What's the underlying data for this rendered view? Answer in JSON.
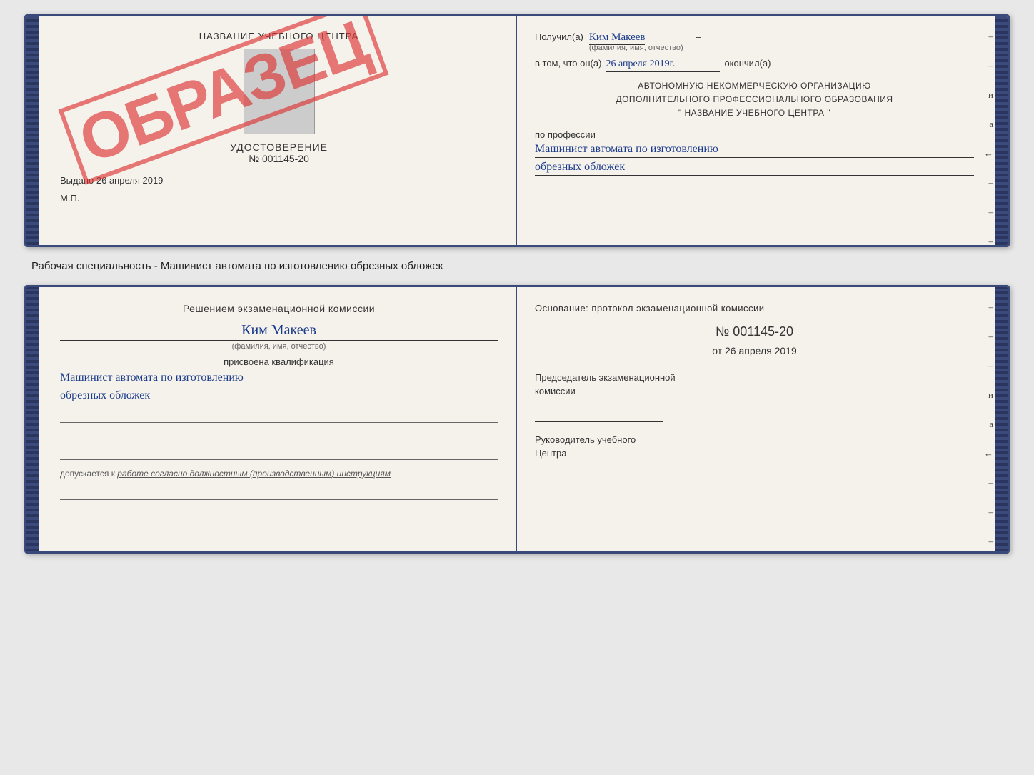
{
  "top_document": {
    "left": {
      "title": "НАЗВАНИЕ УЧЕБНОГО ЦЕНТРА",
      "photo_alt": "фото",
      "certificate_label": "УДОСТОВЕРЕНИЕ",
      "number_label": "№ 001145-20",
      "issued_text": "Выдано",
      "issued_date": "26 апреля 2019",
      "mp_label": "М.П.",
      "stamp_text": "ОБРАЗЕЦ"
    },
    "right": {
      "recipient_prefix": "Получил(а)",
      "recipient_name": "Ким Макеев",
      "recipient_sublabel": "(фамилия, имя, отчество)",
      "date_prefix": "в том, что он(а)",
      "date_value": "26 апреля 2019г.",
      "finished_label": "окончил(а)",
      "org_line1": "АВТОНОМНУЮ НЕКОММЕРЧЕСКУЮ ОРГАНИЗАЦИЮ",
      "org_line2": "ДОПОЛНИТЕЛЬНОГО ПРОФЕССИОНАЛЬНОГО ОБРАЗОВАНИЯ",
      "org_line3": "\"   НАЗВАНИЕ УЧЕБНОГО ЦЕНТРА   \"",
      "profession_label": "по профессии",
      "profession_line1": "Машинист автомата по изготовлению",
      "profession_line2": "обрезных обложек",
      "right_markers": [
        "–",
        "–",
        "–",
        "и",
        "а",
        "←",
        "–",
        "–",
        "–",
        "–"
      ]
    }
  },
  "specialty_text": "Рабочая специальность - Машинист автомата по изготовлению обрезных обложек",
  "bottom_document": {
    "left": {
      "commission_line1": "Решением  экзаменационной  комиссии",
      "person_name": "Ким Макеев",
      "person_sublabel": "(фамилия, имя, отчество)",
      "qualification_label": "присвоена квалификация",
      "qualification_line1": "Машинист автомата по изготовлению",
      "qualification_line2": "обрезных обложек",
      "empty_lines": 3,
      "admission_text": "допускается к",
      "admission_italic": "работе согласно должностным (производственным) инструкциям"
    },
    "right": {
      "basis_text": "Основание:  протокол  экзаменационной  комиссии",
      "protocol_number": "№  001145-20",
      "date_prefix": "от",
      "date_value": "26 апреля 2019",
      "chairman_label1": "Председатель экзаменационной",
      "chairman_label2": "комиссии",
      "head_label1": "Руководитель учебного",
      "head_label2": "Центра",
      "right_markers": [
        "–",
        "–",
        "–",
        "–",
        "–",
        "и",
        "а",
        "←",
        "–",
        "–",
        "–",
        "–"
      ]
    }
  }
}
